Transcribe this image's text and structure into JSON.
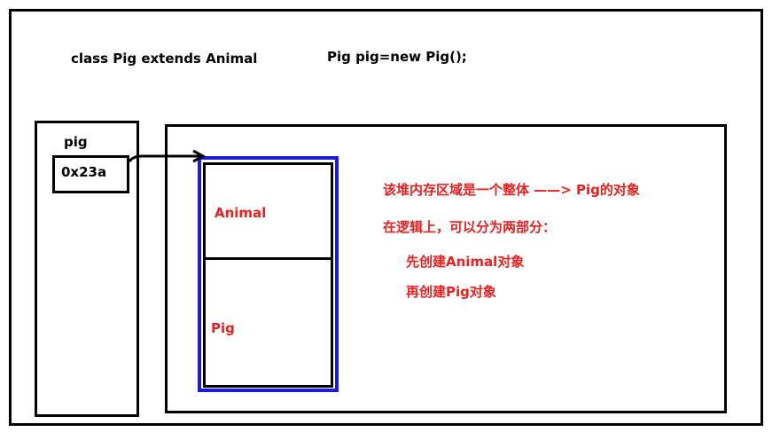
{
  "code": {
    "class_decl": "class Pig extends Animal",
    "instantiation": "Pig pig=new Pig();"
  },
  "stack": {
    "var_name": "pig",
    "ref_value": "0x23a"
  },
  "heap": {
    "object_sections": {
      "top": "Animal",
      "bottom": "Pig"
    }
  },
  "notes": {
    "line1": "该堆内存区域是一个整体 ——> Pig的对象",
    "line2": "在逻辑上，可以分为两部分：",
    "line3": "先创建Animal对象",
    "line4": "再创建Pig对象"
  },
  "colors": {
    "note_text": "#e82020",
    "object_border": "#1a1adc",
    "frame": "#000000"
  }
}
